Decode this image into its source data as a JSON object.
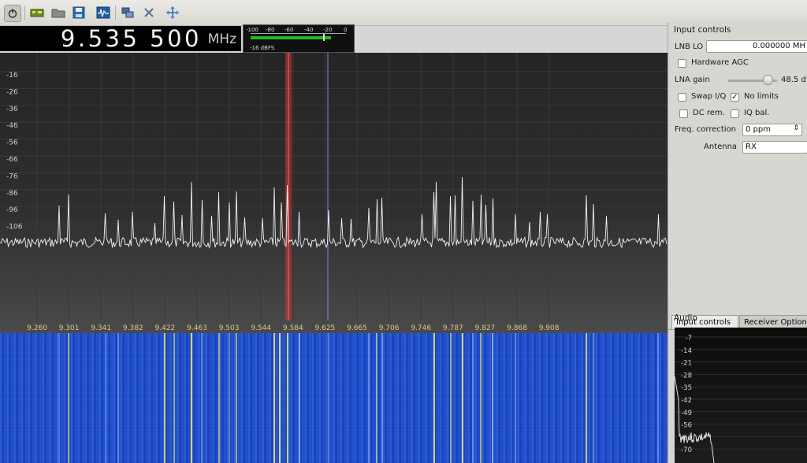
{
  "toolbar": {
    "icons": [
      "power-icon",
      "device-icon",
      "open-folder-icon",
      "save-icon",
      "signal-icon",
      "remote-control-icon",
      "tools-icon",
      "fit-view-icon"
    ]
  },
  "frequency": {
    "value": "9.535 500",
    "unit": "MHz"
  },
  "meter": {
    "ticks": [
      "-100",
      "-80",
      "-60",
      "-40",
      "-20",
      "0"
    ],
    "reading": "-16 dBFS",
    "level_dbfs": -16
  },
  "spectrum": {
    "db_labels": [
      "-16",
      "-26",
      "-36",
      "-46",
      "-56",
      "-66",
      "-76",
      "-86",
      "-96",
      "-106"
    ],
    "freq_labels": [
      "9.260",
      "9.301",
      "9.341",
      "9.382",
      "9.422",
      "9.463",
      "9.503",
      "9.544",
      "9.584",
      "9.625",
      "9.665",
      "9.706",
      "9.746",
      "9.787",
      "9.827",
      "9.868",
      "9.908"
    ],
    "colors": {
      "trace": "#f2f2f2",
      "filter": "#cc3333",
      "demod_line": "#8888cc"
    }
  },
  "input_controls": {
    "title": "Input controls",
    "lnb_lo_label": "LNB LO",
    "lnb_lo_value": "0.000000 MH",
    "hardware_agc": "Hardware AGC",
    "lna_gain_label": "LNA gain",
    "lna_gain_value": "48.5 d",
    "lna_gain_fraction": 0.8,
    "swap_iq": "Swap I/Q",
    "no_limits": "No limits",
    "dc_rem": "DC rem.",
    "iq_bal": "IQ bal.",
    "freq_correction_label": "Freq. correction",
    "freq_correction_value": "0 ppm",
    "antenna_label": "Antenna",
    "antenna_value": "RX"
  },
  "tabs": [
    "Input controls",
    "Receiver Option"
  ],
  "audio": {
    "title": "Audio",
    "db_labels": [
      "-7",
      "-14",
      "-21",
      "-28",
      "-35",
      "-42",
      "-49",
      "-56",
      "-63",
      "-70"
    ]
  }
}
